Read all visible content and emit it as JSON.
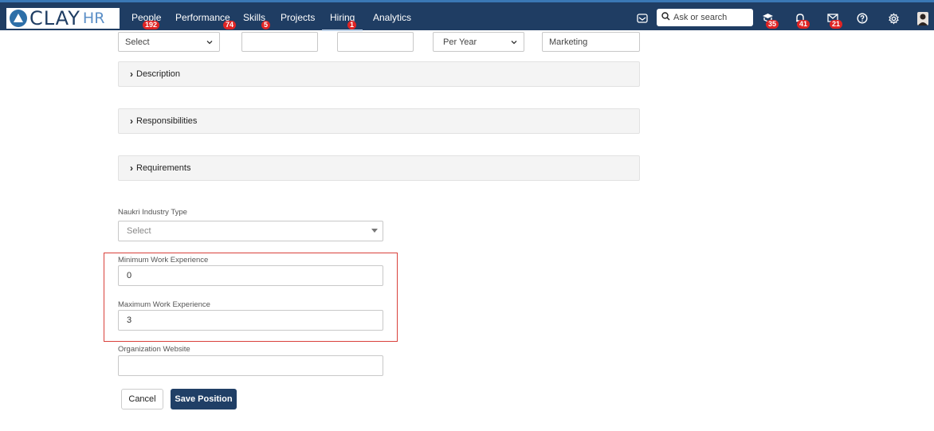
{
  "app": {
    "logo_text_main": "CLAY",
    "logo_text_sub": "HR"
  },
  "nav": {
    "items": [
      {
        "label": "People",
        "badge": "192"
      },
      {
        "label": "Performance",
        "badge": "74"
      },
      {
        "label": "Skills",
        "badge": "5"
      },
      {
        "label": "Projects",
        "badge": ""
      },
      {
        "label": "Hiring",
        "badge": "1"
      },
      {
        "label": "Analytics",
        "badge": ""
      }
    ],
    "active": "Hiring",
    "search_placeholder": "Ask or search",
    "icons": [
      {
        "name": "inbox-icon",
        "badge": ""
      },
      {
        "name": "learning-icon",
        "badge": "35"
      },
      {
        "name": "notifications-icon",
        "badge": "41"
      },
      {
        "name": "mail-icon",
        "badge": "21"
      },
      {
        "name": "help-icon",
        "badge": ""
      },
      {
        "name": "settings-icon",
        "badge": ""
      },
      {
        "name": "avatar-icon",
        "badge": ""
      }
    ]
  },
  "top_row": {
    "select_1": "Select",
    "input_2": "",
    "input_3": "",
    "period_select": "Per Year",
    "department": "Marketing"
  },
  "sections": [
    {
      "label": "Description"
    },
    {
      "label": "Responsibilities"
    },
    {
      "label": "Requirements"
    }
  ],
  "form": {
    "industry_label": "Naukri Industry Type",
    "industry_placeholder": "Select",
    "min_exp_label": "Minimum Work Experience",
    "min_exp_value": "0",
    "max_exp_label": "Maximum Work Experience",
    "max_exp_value": "3",
    "website_label": "Organization Website",
    "website_value": ""
  },
  "actions": {
    "cancel_label": "Cancel",
    "save_label": "Save Position"
  },
  "colors": {
    "topbar": "#1f3d63",
    "badge": "#e02424",
    "primary_button": "#203f66",
    "highlight": "#d9413b"
  }
}
